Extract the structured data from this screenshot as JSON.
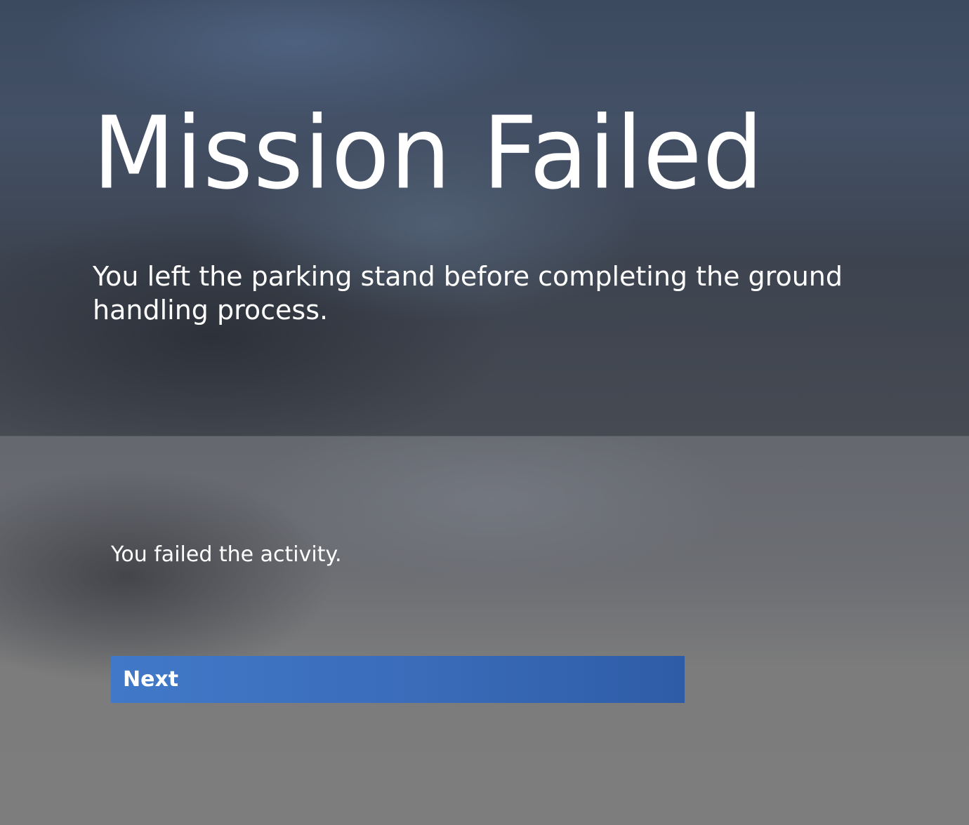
{
  "header": {
    "title": "Mission Failed",
    "message": "You left the parking stand before completing the ground handling process."
  },
  "result": {
    "text": "You failed the activity."
  },
  "actions": {
    "next_label": "Next"
  },
  "colors": {
    "button_bg": "#3a6dbb",
    "text": "#ffffff"
  }
}
